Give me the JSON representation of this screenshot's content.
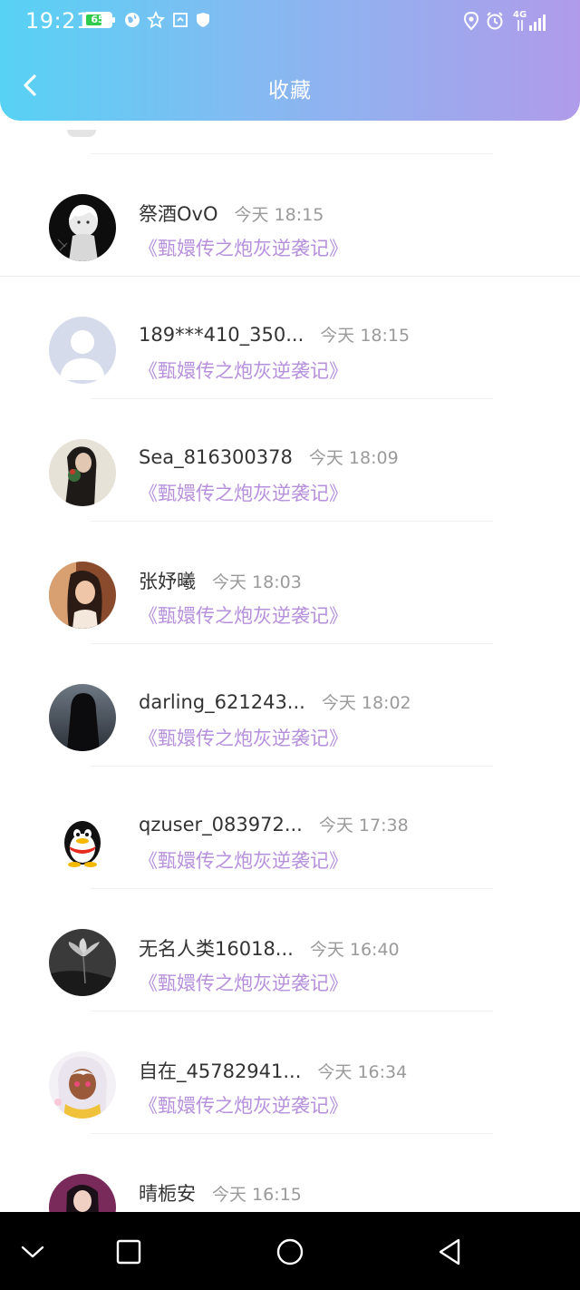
{
  "status_bar": {
    "time": "19:21",
    "battery": "65",
    "network": "4G"
  },
  "header": {
    "title": "收藏"
  },
  "colors": {
    "header_gradient_start": "#57d2f4",
    "header_gradient_end": "#b09bea",
    "book_title": "#b790dc",
    "name": "#333333",
    "time": "#9a9a9a"
  },
  "items": [
    {
      "name": "祭酒OvO",
      "time": "今天 18:15",
      "book": "《甄嬛传之炮灰逆袭记》",
      "avatar": "anime-dark-avatar"
    },
    {
      "name": "189***410_350...",
      "time": "今天 18:15",
      "book": "《甄嬛传之炮灰逆袭记》",
      "avatar": "default-avatar"
    },
    {
      "name": "Sea_816300378",
      "time": "今天 18:09",
      "book": "《甄嬛传之炮灰逆袭记》",
      "avatar": "photo-avatar"
    },
    {
      "name": "张妤曦",
      "time": "今天 18:03",
      "book": "《甄嬛传之炮灰逆袭记》",
      "avatar": "photo-avatar"
    },
    {
      "name": "darling_621243...",
      "time": "今天 18:02",
      "book": "《甄嬛传之炮灰逆袭记》",
      "avatar": "hooded-figure-avatar"
    },
    {
      "name": "qzuser_083972...",
      "time": "今天 17:38",
      "book": "《甄嬛传之炮灰逆袭记》",
      "avatar": "penguin-avatar"
    },
    {
      "name": "无名人类16018...",
      "time": "今天 16:40",
      "book": "《甄嬛传之炮灰逆袭记》",
      "avatar": "flower-avatar"
    },
    {
      "name": "自在_45782941...",
      "time": "今天 16:34",
      "book": "《甄嬛传之炮灰逆袭记》",
      "avatar": "anime-girl-avatar"
    },
    {
      "name": "晴栀安",
      "time": "今天 16:15",
      "book": "",
      "avatar": "photo-avatar"
    }
  ]
}
